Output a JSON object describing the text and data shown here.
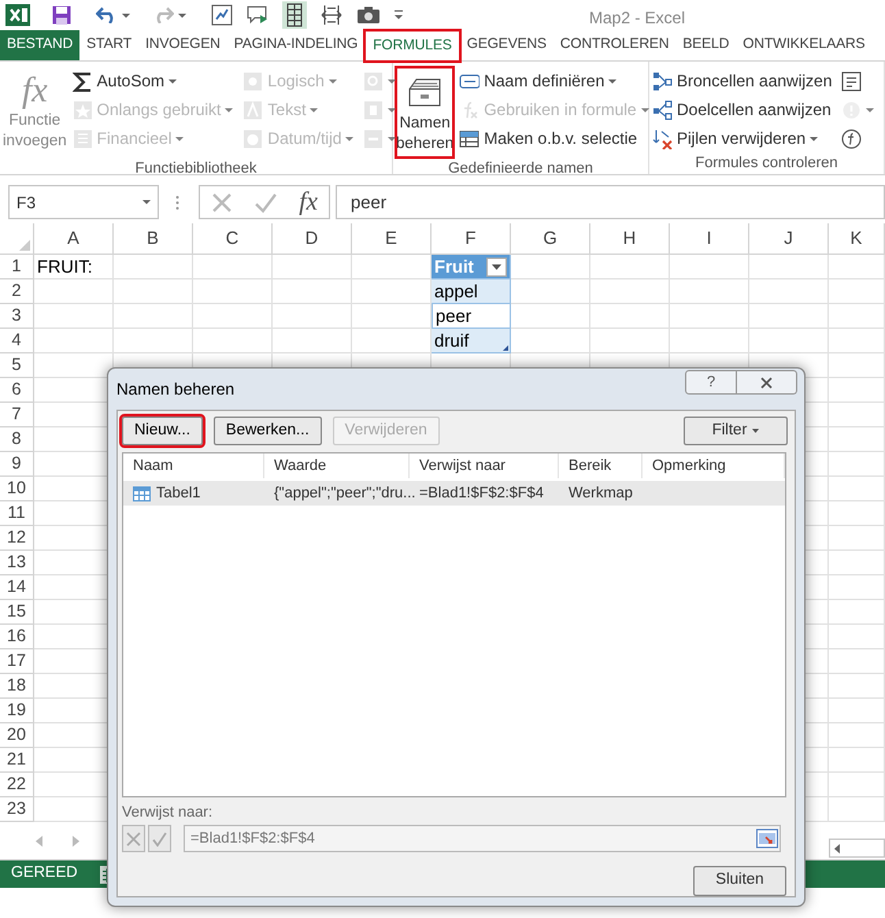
{
  "window": {
    "title": "Map2 - Excel"
  },
  "ribbon_tabs": [
    {
      "label": "BESTAND",
      "kind": "file",
      "selected": false,
      "highlighted": false
    },
    {
      "label": "START",
      "kind": "tab",
      "selected": false,
      "highlighted": false
    },
    {
      "label": "INVOEGEN",
      "kind": "tab",
      "selected": false,
      "highlighted": false
    },
    {
      "label": "PAGINA-INDELING",
      "kind": "tab",
      "selected": false,
      "highlighted": false
    },
    {
      "label": "FORMULES",
      "kind": "tab",
      "selected": true,
      "highlighted": true
    },
    {
      "label": "GEGEVENS",
      "kind": "tab",
      "selected": false,
      "highlighted": false
    },
    {
      "label": "CONTROLEREN",
      "kind": "tab",
      "selected": false,
      "highlighted": false
    },
    {
      "label": "BEELD",
      "kind": "tab",
      "selected": false,
      "highlighted": false
    },
    {
      "label": "ONTWIKKELAARS",
      "kind": "tab",
      "selected": false,
      "highlighted": false
    }
  ],
  "ribbon_groups": [
    {
      "label": "Functiebibliotheek",
      "large_button": {
        "icon_text": "fx",
        "label": "Functie invoegen",
        "disabled": true,
        "highlighted": false
      },
      "columns": [
        [
          {
            "label": "AutoSom",
            "disabled": false,
            "dropdown": true
          },
          {
            "label": "Onlangs gebruikt",
            "disabled": true,
            "dropdown": true
          },
          {
            "label": "Financieel",
            "disabled": true,
            "dropdown": true
          }
        ],
        [
          {
            "label": "Logisch",
            "disabled": true,
            "dropdown": true
          },
          {
            "label": "Tekst",
            "disabled": true,
            "dropdown": true
          },
          {
            "label": "Datum/tijd",
            "disabled": true,
            "dropdown": true
          }
        ],
        [
          {
            "disabled": true,
            "dropdown": true
          },
          {
            "disabled": true,
            "dropdown": true
          },
          {
            "disabled": true,
            "dropdown": true
          }
        ]
      ]
    },
    {
      "label": "Gedefinieerde namen",
      "large_button": {
        "label": "Namen beheren",
        "disabled": false,
        "highlighted": true
      },
      "columns": [
        [
          {
            "label": "Naam definiëren",
            "disabled": false,
            "dropdown": true
          },
          {
            "label": "Gebruiken in formule",
            "disabled": true,
            "dropdown": true
          },
          {
            "label": "Maken o.b.v. selectie",
            "disabled": false,
            "dropdown": false
          }
        ]
      ]
    },
    {
      "label": "Formules controleren",
      "columns": [
        [
          {
            "label": "Broncellen aanwijzen",
            "disabled": false,
            "dropdown": false
          },
          {
            "label": "Doelcellen aanwijzen",
            "disabled": false,
            "dropdown": false
          },
          {
            "label": "Pijlen verwijderen",
            "disabled": false,
            "dropdown": true
          }
        ],
        [
          {
            "disabled": false,
            "dropdown": false
          },
          {
            "disabled": true,
            "dropdown": true
          },
          {
            "disabled": false,
            "dropdown": false
          }
        ]
      ]
    }
  ],
  "formula_bar": {
    "name_box": "F3",
    "function_button": "fx",
    "value": "peer"
  },
  "sheet": {
    "columns": [
      "A",
      "B",
      "C",
      "D",
      "E",
      "F",
      "G",
      "H",
      "I",
      "J",
      "K"
    ],
    "rows": [
      {
        "number": "1",
        "cells": [
          {
            "text": "FRUIT:",
            "kind": "plain"
          },
          null,
          null,
          null,
          null,
          {
            "text": "Fruit",
            "kind": "table_header"
          },
          null,
          null,
          null,
          null,
          null
        ]
      },
      {
        "number": "2",
        "cells": [
          null,
          null,
          null,
          null,
          null,
          {
            "text": "appel",
            "kind": "table_band"
          },
          null,
          null,
          null,
          null,
          null
        ]
      },
      {
        "number": "3",
        "cells": [
          null,
          null,
          null,
          null,
          null,
          {
            "text": "peer",
            "kind": "table_row"
          },
          null,
          null,
          null,
          null,
          null
        ]
      },
      {
        "number": "4",
        "cells": [
          null,
          null,
          null,
          null,
          null,
          {
            "text": "druif",
            "kind": "table_band",
            "resize_handle": true
          },
          null,
          null,
          null,
          null,
          null
        ]
      },
      {
        "number": "5"
      },
      {
        "number": "6"
      },
      {
        "number": "7"
      },
      {
        "number": "8"
      },
      {
        "number": "9"
      },
      {
        "number": "10"
      },
      {
        "number": "11"
      },
      {
        "number": "12"
      },
      {
        "number": "13"
      },
      {
        "number": "14"
      },
      {
        "number": "15"
      },
      {
        "number": "16"
      },
      {
        "number": "17"
      },
      {
        "number": "18"
      },
      {
        "number": "19"
      },
      {
        "number": "20"
      },
      {
        "number": "21"
      },
      {
        "number": "22"
      },
      {
        "number": "23"
      }
    ]
  },
  "status_bar": {
    "text": "GEREED"
  },
  "dialog": {
    "title": "Namen beheren",
    "help_button": "?",
    "buttons": [
      {
        "label": "Nieuw...",
        "disabled": false,
        "highlighted": true
      },
      {
        "label": "Bewerken...",
        "disabled": false,
        "highlighted": false
      },
      {
        "label": "Verwijderen",
        "disabled": true,
        "highlighted": false
      }
    ],
    "filter_button": "Filter",
    "columns": [
      "Naam",
      "Waarde",
      "Verwijst naar",
      "Bereik",
      "Opmerking"
    ],
    "rows": [
      {
        "name": "Tabel1",
        "value": "{\"appel\";\"peer\";\"dru...",
        "refers_to": "=Blad1!$F$2:$F$4",
        "scope": "Werkmap",
        "selected": true
      }
    ],
    "refers_to_label": "Verwijst naar:",
    "refers_to_value": "=Blad1!$F$2:$F$4",
    "close_button": "Sluiten"
  }
}
